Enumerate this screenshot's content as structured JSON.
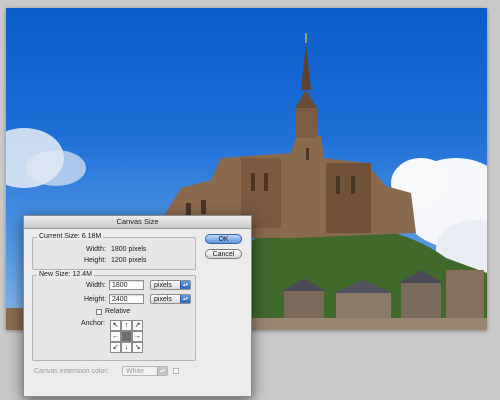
{
  "dialog": {
    "title": "Canvas Size",
    "current_size": {
      "legend": "Current Size: 6.18M",
      "width_label": "Width:",
      "width_value": "1800 pixels",
      "height_label": "Height:",
      "height_value": "1200 pixels"
    },
    "new_size": {
      "legend": "New Size: 12.4M",
      "width_label": "Width:",
      "width_value": "1800",
      "width_unit": "pixels",
      "height_label": "Height:",
      "height_value": "2400",
      "height_unit": "pixels",
      "relative_label": "Relative",
      "relative_checked": false,
      "anchor_label": "Anchor:",
      "anchor_arrows": [
        "↖",
        "↑",
        "↗",
        "←",
        "",
        "→",
        "↙",
        "↓",
        "↘"
      ]
    },
    "extension_color_label": "Canvas extension color:",
    "extension_color_value": "White",
    "ok_label": "OK",
    "cancel_label": "Cancel"
  },
  "colors": {
    "sky": "#1f6fd8",
    "accent_button": "#5a95e4"
  }
}
